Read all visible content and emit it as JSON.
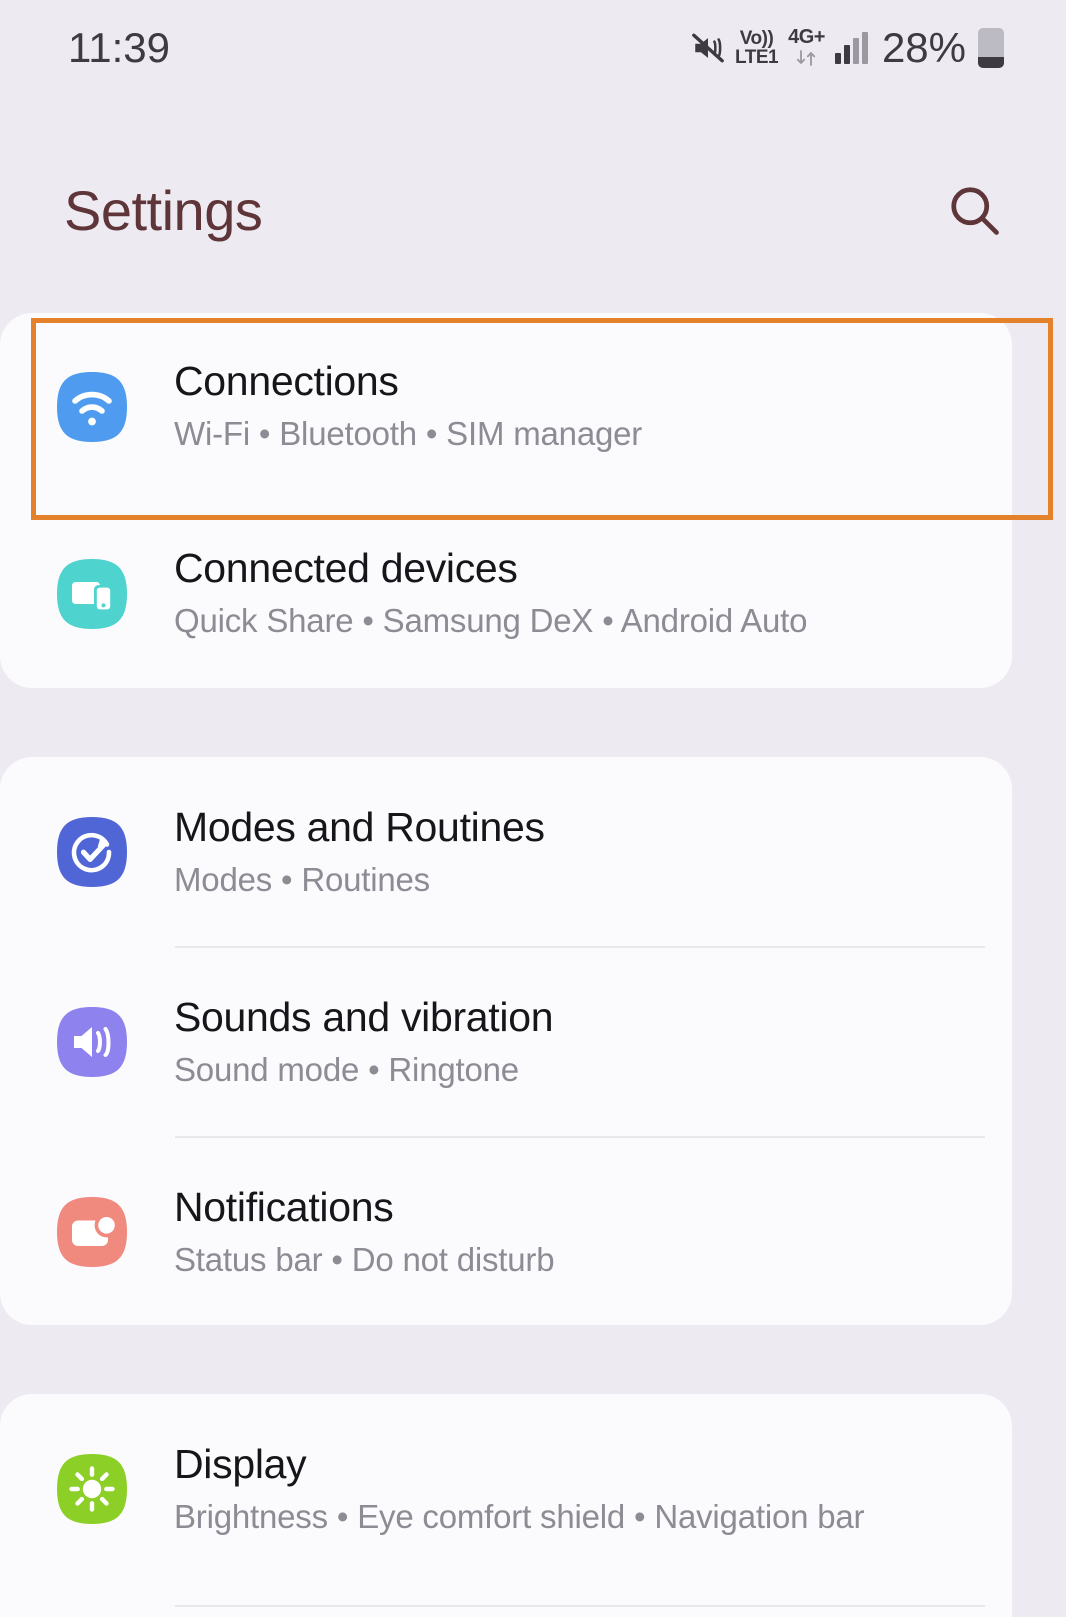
{
  "status_bar": {
    "time": "11:39",
    "mute_icon": "mute-vibrate-icon",
    "volte_line1": "Vo))",
    "volte_line2": "LTE1",
    "network_type": "4G+",
    "data_arrows_icon": "data-transfer-arrows-icon",
    "signal_icon": "signal-bars-icon",
    "battery_percent": "28%",
    "battery_icon": "battery-icon"
  },
  "header": {
    "title": "Settings",
    "search_icon": "search-icon",
    "title_color": "#5E3538"
  },
  "theme": {
    "background": "#EEEAF2",
    "card": "#FBFAFC",
    "divider": "#E9E7EC",
    "highlight_border": "#E4812B",
    "title_text": "#16151A",
    "subtitle_text": "#8D8B94"
  },
  "highlight": {
    "target": "Connections",
    "color": "#E4812B"
  },
  "sections": [
    {
      "id": "connections-card",
      "items": [
        {
          "name": "connections",
          "title": "Connections",
          "subtitle": "Wi-Fi  •  Bluetooth  •  SIM manager",
          "icon": "wifi-icon",
          "icon_color": "#4E9BEF",
          "highlighted": true
        },
        {
          "name": "connected-devices",
          "title": "Connected devices",
          "subtitle": "Quick Share  •  Samsung DeX  •  Android Auto",
          "icon": "connected-devices-icon",
          "icon_color": "#4ED3CE",
          "highlighted": false
        }
      ]
    },
    {
      "id": "modes-card",
      "items": [
        {
          "name": "modes-and-routines",
          "title": "Modes and Routines",
          "subtitle": "Modes  •  Routines",
          "icon": "modes-routines-icon",
          "icon_color": "#5066D6",
          "highlighted": false
        },
        {
          "name": "sounds-and-vibration",
          "title": "Sounds and vibration",
          "subtitle": "Sound mode  •  Ringtone",
          "icon": "speaker-icon",
          "icon_color": "#8E82EE",
          "highlighted": false
        },
        {
          "name": "notifications",
          "title": "Notifications",
          "subtitle": "Status bar  •  Do not disturb",
          "icon": "notification-icon",
          "icon_color": "#F08A7E",
          "highlighted": false
        }
      ]
    },
    {
      "id": "display-card",
      "items": [
        {
          "name": "display",
          "title": "Display",
          "subtitle": "Brightness  •  Eye comfort shield  •  Navigation bar",
          "icon": "brightness-sun-icon",
          "icon_color": "#8CD027",
          "highlighted": false
        }
      ]
    }
  ]
}
